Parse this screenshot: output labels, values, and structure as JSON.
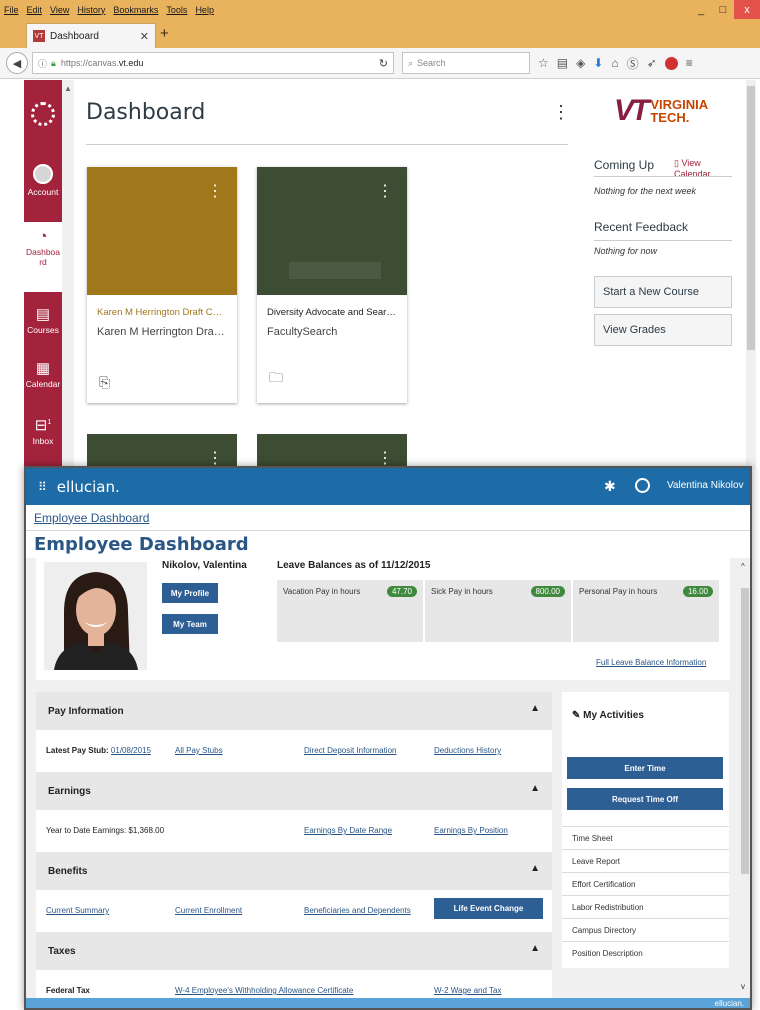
{
  "browser": {
    "menu": [
      "File",
      "Edit",
      "View",
      "History",
      "Bookmarks",
      "Tools",
      "Help"
    ],
    "window_controls": [
      "_",
      "□",
      "x"
    ],
    "tab_title": "Dashboard",
    "tab_favicon_text": "VT",
    "url_prefix": "https://canvas.",
    "url_domain": "vt.edu",
    "search_placeholder": "Search"
  },
  "canvas": {
    "nav": {
      "account": "Account",
      "dashboard": "Dashboa rd",
      "courses": "Courses",
      "calendar": "Calendar",
      "inbox": "Inbox",
      "inbox_count": "1"
    },
    "title": "Dashboard",
    "cards": [
      {
        "title": "Karen M Herrington Draft Course",
        "code": "Karen M Herrington Draft Co...",
        "color": "#a0771a",
        "title_color": "#a0771a"
      },
      {
        "title": "Diversity Advocate and Search Ch...",
        "code": "FacultySearch",
        "color": "#3d4d33",
        "title_color": "#222222"
      }
    ],
    "small_cards_color": "#3d4d33",
    "logo_top": "VIRGINIA",
    "logo_bottom": "TECH.",
    "coming_up": "Coming Up",
    "view_calendar": "View Calendar",
    "coming_up_text": "Nothing for the next week",
    "recent_feedback": "Recent Feedback",
    "recent_feedback_text": "Nothing for now",
    "start_new_course": "Start a New Course",
    "view_grades": "View Grades",
    "accent": "#a3233d"
  },
  "ellucian": {
    "brand": "ellucian.",
    "user_name": "Valentina Nikolov",
    "breadcrumb": "Employee Dashboard",
    "title": "Employee Dashboard",
    "employee_name": "Nikolov, Valentina",
    "my_profile": "My Profile",
    "my_team": "My Team",
    "leave_title": "Leave Balances as of 11/12/2015",
    "leave": [
      {
        "label": "Vacation Pay in hours",
        "value": "47.70"
      },
      {
        "label": "Sick Pay in hours",
        "value": "800.00"
      },
      {
        "label": "Personal Pay in hours",
        "value": "16.00"
      }
    ],
    "full_leave_link": "Full Leave Balance Information",
    "pay": {
      "title": "Pay Information",
      "latest_label": "Latest Pay Stub:",
      "latest_date": "01/08/2015",
      "all_stubs": "All Pay Stubs",
      "direct_deposit": "Direct Deposit Information",
      "deductions": "Deductions History"
    },
    "earnings": {
      "title": "Earnings",
      "ytd": "Year to Date Earnings: $1,368.00",
      "by_range": "Earnings By Date Range",
      "by_position": "Earnings By Position"
    },
    "benefits": {
      "title": "Benefits",
      "summary": "Current Summary",
      "enrollment": "Current Enrollment",
      "beneficiaries": "Beneficiaries and Dependents",
      "life_event": "Life Event Change"
    },
    "taxes": {
      "title": "Taxes",
      "federal": "Federal Tax",
      "w4": "W-4 Employee's Withholding Allowance Certificate",
      "w2": "W-2 Wage and Tax"
    },
    "activities": {
      "title": "My Activities",
      "enter_time": "Enter Time",
      "request_time_off": "Request Time Off",
      "items": [
        "Time Sheet",
        "Leave Report",
        "Effort Certification",
        "Labor Redistribution",
        "Campus Directory",
        "Position Description"
      ]
    },
    "footer_brand": "ellucian.",
    "header_color": "#1e6ca7",
    "button_color": "#2e5f94"
  }
}
